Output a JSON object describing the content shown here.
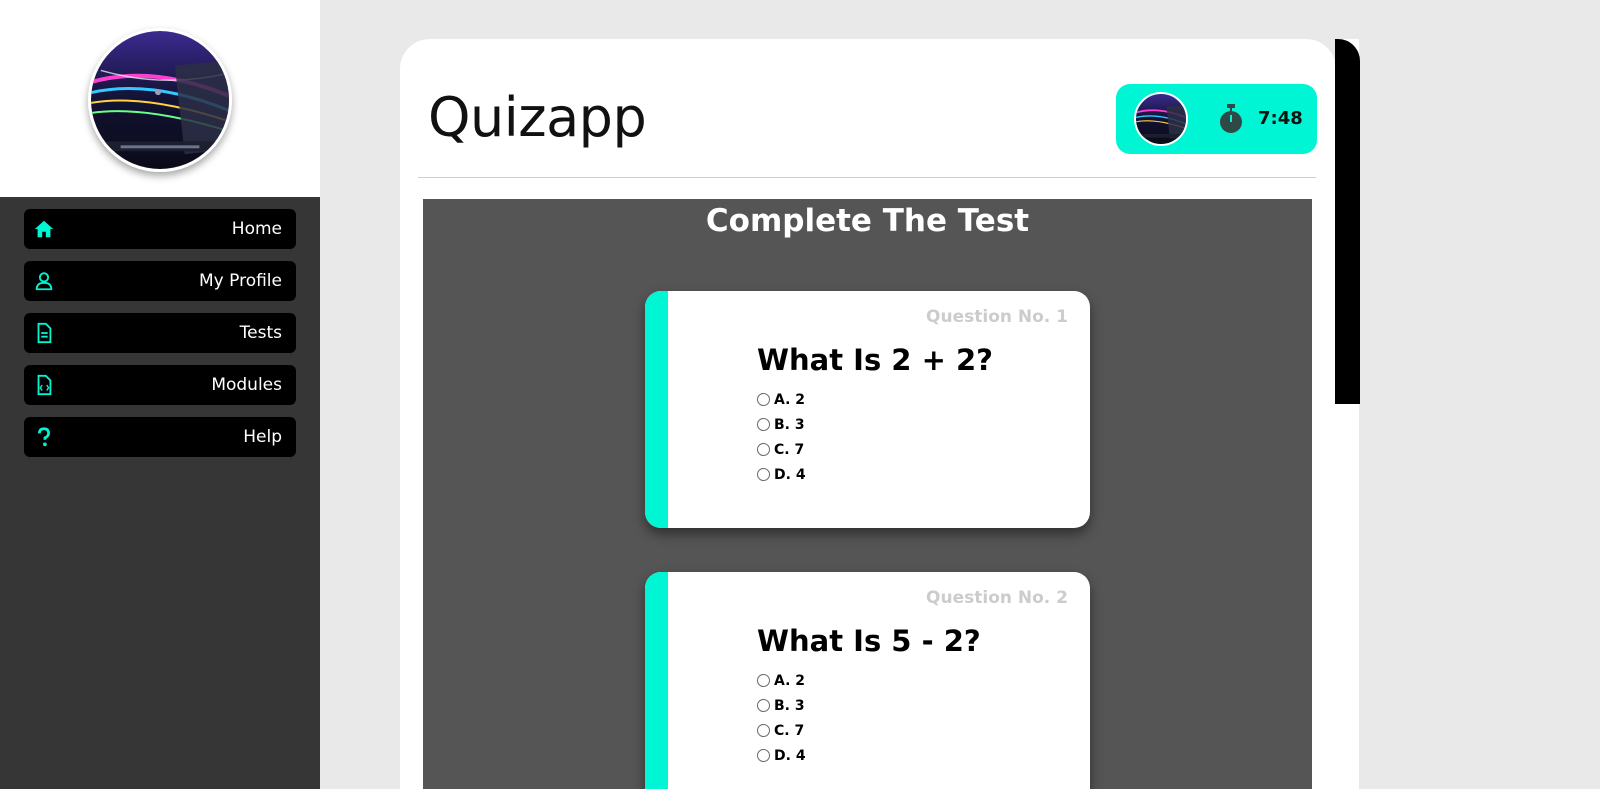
{
  "sidebar": {
    "items": [
      {
        "label": "Home",
        "icon": "home-icon"
      },
      {
        "label": "My Profile",
        "icon": "user-icon"
      },
      {
        "label": "Tests",
        "icon": "document-icon"
      },
      {
        "label": "Modules",
        "icon": "code-file-icon"
      },
      {
        "label": "Help",
        "icon": "question-icon"
      }
    ]
  },
  "header": {
    "title": "Quizapp",
    "timer": "7:48"
  },
  "test": {
    "heading": "Complete The Test",
    "questions": [
      {
        "number": "Question No. 1",
        "text": "What Is 2 + 2?",
        "options": [
          "A. 2",
          "B. 3",
          "C. 7",
          "D. 4"
        ]
      },
      {
        "number": "Question No. 2",
        "text": "What Is 5 - 2?",
        "options": [
          "A. 2",
          "B. 3",
          "C. 7",
          "D. 4"
        ]
      }
    ]
  },
  "colors": {
    "accent": "#00f5d4",
    "sidebar_bg": "#363636",
    "panel_bg": "#555555",
    "nav_bg": "#000000"
  }
}
